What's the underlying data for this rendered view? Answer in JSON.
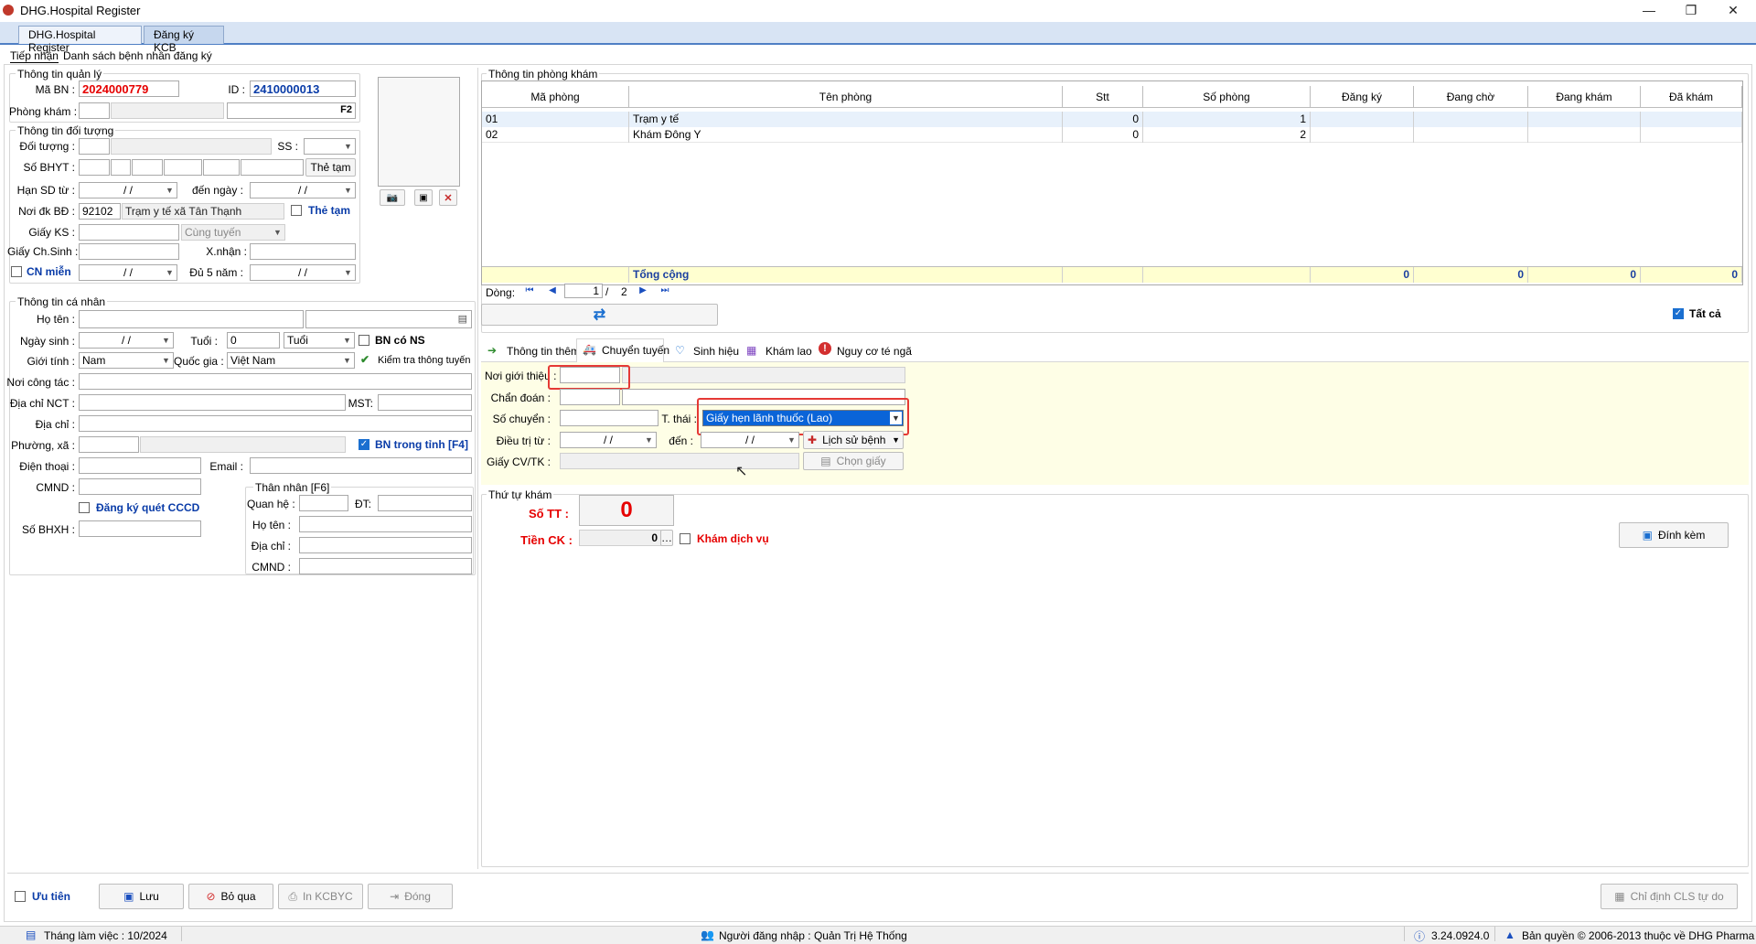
{
  "window": {
    "title": "DHG.Hospital Register",
    "min_label": "—",
    "max_label": "❐",
    "close_label": "✕"
  },
  "doc_tabs": [
    "DHG.Hospital Register",
    "Đăng ký KCB"
  ],
  "sub_tabs": [
    "Tiếp nhận",
    "Danh sách bệnh nhân đăng ký"
  ],
  "admin": {
    "legend": "Thông tin quản lý",
    "ma_bn_label": "Mã BN :",
    "ma_bn": "2024000779",
    "id_label": "ID :",
    "id": "2410000013",
    "phong_kham_label": "Phòng khám :",
    "f2": "F2"
  },
  "subject": {
    "legend": "Thông tin đối tượng",
    "doi_tuong_label": "Đối tượng :",
    "ss_label": "SS :",
    "so_bhyt_label": "Số BHYT :",
    "the_tam_btn": "Thẻ tạm",
    "han_sd_label": "Hạn SD từ :",
    "den_ngay_label": "đến  ngày :",
    "date_placeholder": "/   /",
    "noi_dk_label": "Nơi đk BĐ :",
    "noi_dk_code": "92102",
    "noi_dk_name": "Trạm y tế xã Tân Thạnh",
    "the_tam_chk": "Thẻ tạm",
    "giay_ks_label": "Giấy KS :",
    "cung_tuyen": "Cùng tuyến",
    "giay_chsinh_label": "Giấy Ch.Sinh :",
    "xnhan_label": "X.nhận :",
    "cn_mien_label": "CN miễn",
    "du5nam_label": "Đủ 5 năm :"
  },
  "personal": {
    "legend": "Thông tin cá nhân",
    "ho_ten_label": "Họ tên :",
    "ngay_sinh_label": "Ngày sinh :",
    "tuoi_label": "Tuổi :",
    "tuoi_value": "0",
    "tuoi_unit": "Tuổi",
    "bn_co_ns": "BN có NS",
    "gioi_tinh_label": "Giới tính :",
    "gioi_tinh": "Nam",
    "quoc_gia_label": "Quốc gia :",
    "quoc_gia": "Việt Nam",
    "kiem_tra": "Kiểm tra thông tuyến",
    "noi_cong_tac_label": "Nơi công tác :",
    "dia_chi_nct_label": "Địa chỉ  NCT :",
    "mst_label": "MST:",
    "dia_chi_label": "Địa chỉ :",
    "phuong_xa_label": "Phường, xã :",
    "bn_trong_tinh": "BN trong tỉnh [F4]",
    "dien_thoai_label": "Điện thoại :",
    "email_label": "Email :",
    "cmnd_label": "CMND :",
    "dk_quet_cccd": "Đăng ký quét CCCD",
    "so_bhxh_label": "Số BHXH :"
  },
  "relative": {
    "legend": "Thân nhân [F6]",
    "quan_he_label": "Quan hệ :",
    "dt_label": "ĐT:",
    "ho_ten_label": "Họ tên :",
    "dia_chi_label": "Địa chỉ :",
    "cmnd_label": "CMND :"
  },
  "rooms": {
    "legend": "Thông tin phòng khám",
    "columns": [
      "Mã phòng",
      "Tên phòng",
      "Stt",
      "Số phòng",
      "Đăng ký",
      "Đang chờ",
      "Đang khám",
      "Đã khám"
    ],
    "rows": [
      {
        "ma": "01",
        "ten": "Trạm y tế",
        "stt": "0",
        "so": "1"
      },
      {
        "ma": "02",
        "ten": "Khám Đông Y",
        "stt": "0",
        "so": "2"
      }
    ],
    "total_label": "Tổng cộng",
    "totals": [
      "0",
      "0",
      "0",
      "0"
    ],
    "dong_label": "Dòng:",
    "page_current": "1",
    "page_sep": "/",
    "page_total": "2",
    "tat_ca": "Tất cả"
  },
  "tabs2": [
    "Thông tin thêm",
    "Chuyển tuyến",
    "Sinh hiệu",
    "Khám lao",
    "Nguy cơ té ngã"
  ],
  "transfer": {
    "noi_gioi_thieu_label": "Nơi giới thiệu :",
    "chan_doan_label": "Chẩn đoán :",
    "so_chuyen_label": "Số chuyển :",
    "t_thai_label": "T. thái :",
    "t_thai_value": "Giấy hẹn lãnh thuốc (Lao)",
    "dieu_tri_label": "Điều trị từ :",
    "den_label": "đến :",
    "lich_su_btn": "Lịch sử bệnh",
    "giay_cv_label": "Giấy CV/TK :",
    "chon_giay_btn": "Chọn giấy"
  },
  "queue": {
    "legend": "Thứ tự khám",
    "so_tt_label": "Số TT :",
    "so_tt": "0",
    "tien_ck_label": "Tiền CK :",
    "tien_ck": "0",
    "kham_dich_vu": "Khám dịch vụ",
    "dinh_kem": "Đính kèm"
  },
  "bottom": {
    "uu_tien": "Ưu tiên",
    "luu": "Lưu",
    "bo_qua": "Bỏ qua",
    "in_kcbyc": "In KCBYC",
    "dong": "Đóng",
    "chi_dinh": "Chỉ định CLS tự do"
  },
  "status": {
    "thang_lam_viec": "Tháng làm việc : 10/2024",
    "nguoi_dang_nhap": "Người đăng nhập : Quản Trị Hệ Thống",
    "version": "3.24.0924.0",
    "ban_quyen": "Bản quyền © 2006-2013 thuộc về DHG Pharma"
  },
  "colors": {
    "accent": "#1a6fd0",
    "alert": "#e53935",
    "selected": "#0a64d8"
  }
}
